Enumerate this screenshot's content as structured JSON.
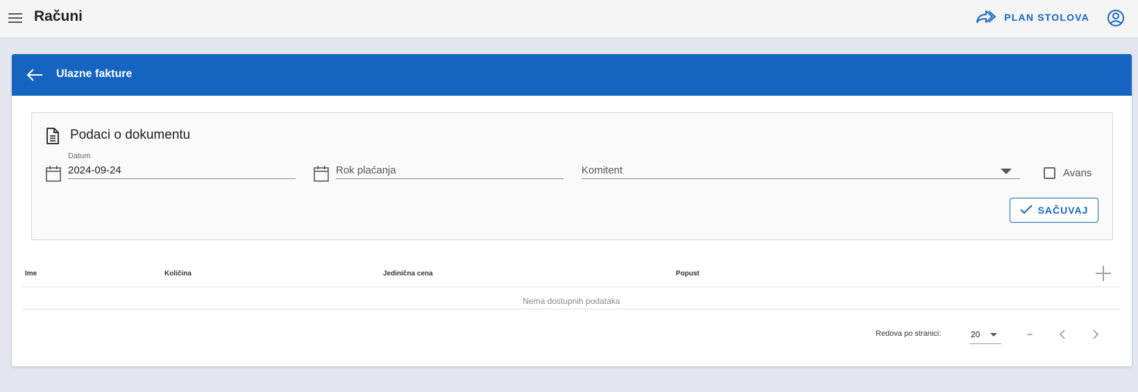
{
  "appbar": {
    "title": "Računi",
    "plan_label": "PLAN STOLOVA",
    "menu_icon": "hamburger-menu-icon",
    "plan_icon": "share-forward-icon",
    "account_icon": "account-circle-icon"
  },
  "card": {
    "header_title": "Ulazne fakture",
    "back_icon": "arrow-left-icon",
    "header_color": "#1565c0"
  },
  "document": {
    "title": "Podaci o dokumentu",
    "title_icon": "document-icon",
    "datum": {
      "label": "Datum",
      "value": "2024-09-24",
      "icon": "calendar-icon"
    },
    "rok_placanja": {
      "placeholder": "Rok plaćanja",
      "icon": "calendar-icon"
    },
    "komitent": {
      "placeholder": "Komitent"
    },
    "avans": {
      "label": "Avans",
      "checked": false
    },
    "save_label": "SAČUVAJ"
  },
  "table": {
    "columns": [
      "Ime",
      "Količina",
      "Jedinična cena",
      "Popust"
    ],
    "empty_text": "Nema dostupnih podataka",
    "rows_per_page_label": "Redova po stranici:",
    "rows_per_page_value": "20",
    "range_text": "–"
  },
  "colors": {
    "accent": "#1565c0",
    "background": "#e3e6ee",
    "appbar": "#f5f5f5"
  }
}
